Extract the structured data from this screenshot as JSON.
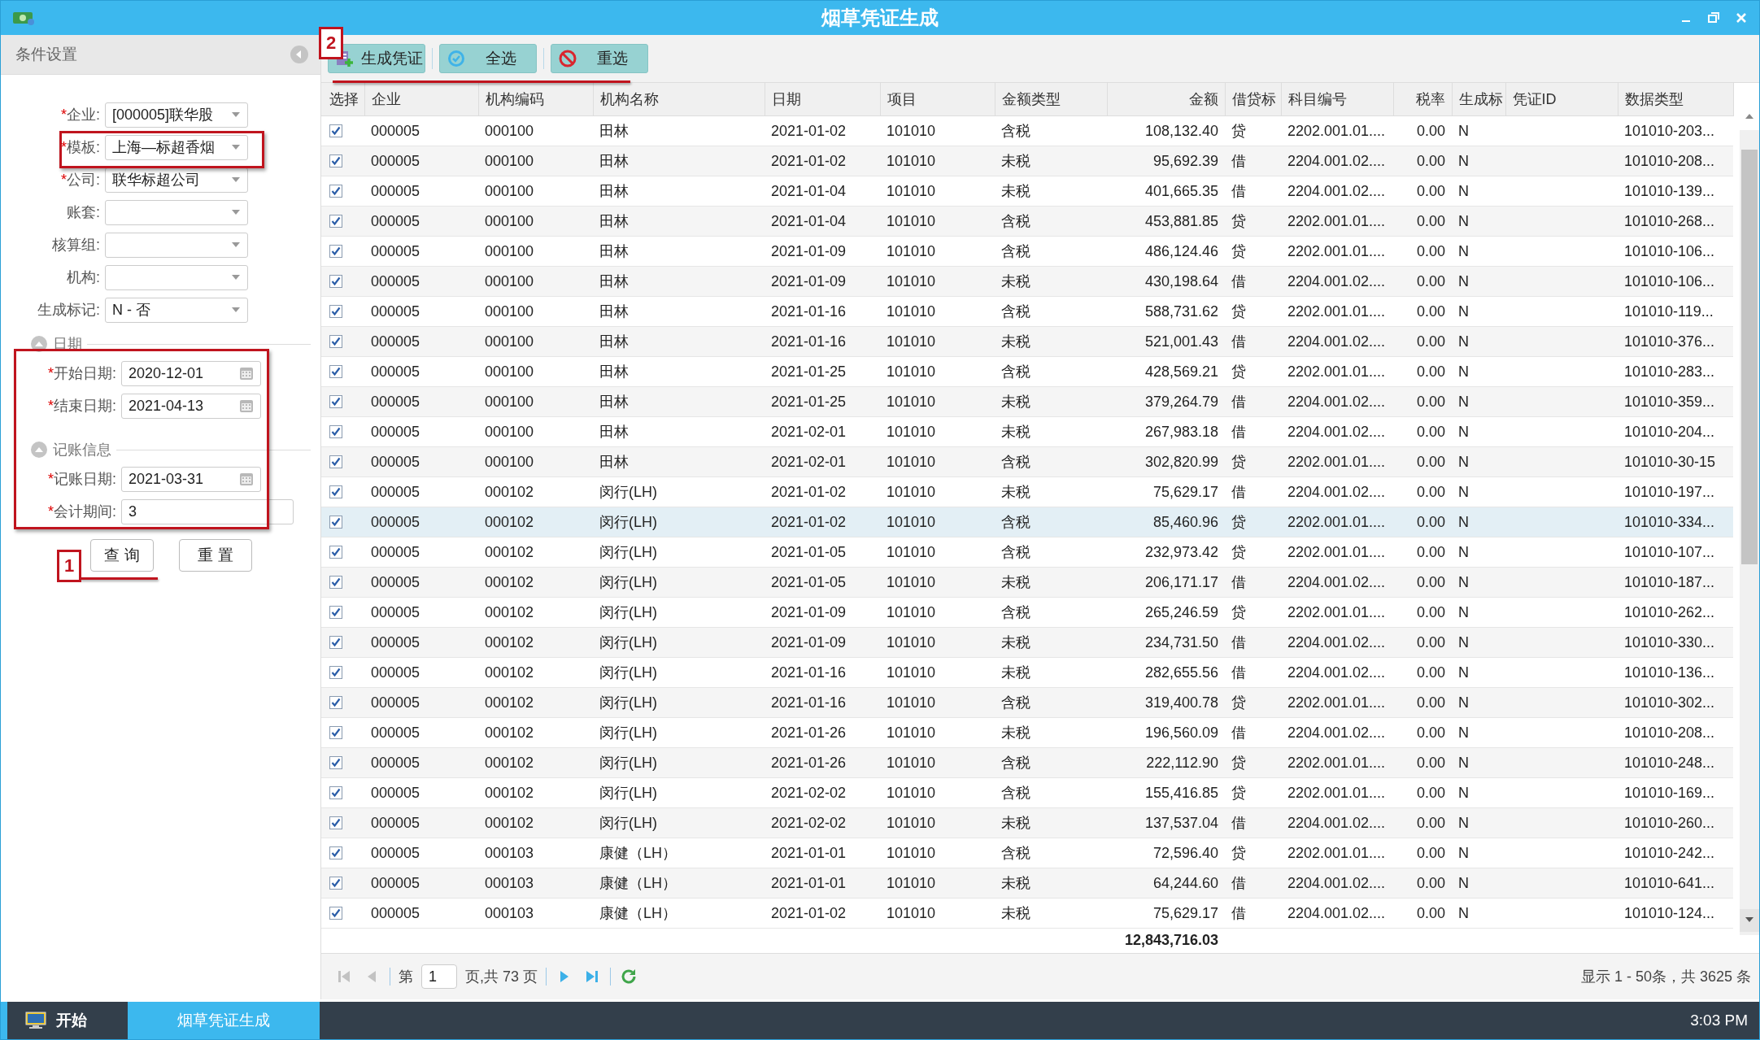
{
  "window": {
    "title": "烟草凭证生成"
  },
  "filter_panel": {
    "title": "条件设置",
    "fields": [
      {
        "kind": "select",
        "mark": "*",
        "label": "企业:",
        "value": "[000005]联华股"
      },
      {
        "kind": "select",
        "mark": "*",
        "label": "模板:",
        "value": "上海—标超香烟"
      },
      {
        "kind": "select",
        "mark": "*",
        "label": "公司:",
        "value": "联华标超公司"
      },
      {
        "kind": "select",
        "label": "账套:"
      },
      {
        "kind": "select",
        "label": "核算组:"
      },
      {
        "kind": "select",
        "label": "机构:"
      },
      {
        "kind": "select",
        "label": "生成标记:",
        "value": "N - 否"
      }
    ],
    "sections": [
      {
        "title": "日期",
        "expanded": true,
        "fields": [
          {
            "kind": "date",
            "mark": "*",
            "label": "开始日期:",
            "value": "2020-12-01"
          },
          {
            "kind": "date",
            "mark": "*",
            "label": "结束日期:",
            "value": "2021-04-13"
          }
        ]
      },
      {
        "title": "记账信息",
        "expanded": true,
        "fields": [
          {
            "kind": "date",
            "mark": "*",
            "label": "记账日期:",
            "value": "2021-03-31"
          },
          {
            "kind": "text",
            "mark": "*",
            "label": "会计期间:",
            "value": "3"
          }
        ]
      }
    ],
    "buttons": [
      "查 询",
      "重 置"
    ]
  },
  "toolbar": [
    {
      "kind": "generate",
      "label": "生成凭证"
    },
    {
      "kind": "select_all",
      "label": "全选"
    },
    {
      "kind": "reset",
      "label": "重选"
    }
  ],
  "table": {
    "columns": [
      {
        "label": "选择",
        "kind": "check"
      },
      {
        "label": "企业",
        "kind": "text"
      },
      {
        "label": "机构编码",
        "kind": "text"
      },
      {
        "label": "机构名称",
        "kind": "text"
      },
      {
        "label": "日期",
        "kind": "text"
      },
      {
        "label": "项目",
        "kind": "text"
      },
      {
        "label": "金额类型",
        "kind": "text"
      },
      {
        "label": "金额",
        "kind": "number"
      },
      {
        "label": "借贷标",
        "kind": "text"
      },
      {
        "label": "科目编号",
        "kind": "text"
      },
      {
        "label": "税率",
        "kind": "number"
      },
      {
        "label": "生成标",
        "kind": "text"
      },
      {
        "label": "凭证ID",
        "kind": "empty"
      },
      {
        "label": "数据类型",
        "kind": "text"
      }
    ],
    "rows": [
      {
        "checked": true,
        "selected": false,
        "cells": [
          "",
          "000005",
          "000100",
          "田林",
          "2021-01-02",
          "101010",
          "含税",
          "108,132.40",
          "贷",
          "2202.001.01....",
          "0.00",
          "N",
          "",
          "101010-203..."
        ]
      },
      {
        "checked": true,
        "selected": false,
        "cells": [
          "",
          "000005",
          "000100",
          "田林",
          "2021-01-02",
          "101010",
          "未税",
          "95,692.39",
          "借",
          "2204.001.02....",
          "0.00",
          "N",
          "",
          "101010-208..."
        ]
      },
      {
        "checked": true,
        "selected": false,
        "cells": [
          "",
          "000005",
          "000100",
          "田林",
          "2021-01-04",
          "101010",
          "未税",
          "401,665.35",
          "借",
          "2204.001.02....",
          "0.00",
          "N",
          "",
          "101010-139..."
        ]
      },
      {
        "checked": true,
        "selected": false,
        "cells": [
          "",
          "000005",
          "000100",
          "田林",
          "2021-01-04",
          "101010",
          "含税",
          "453,881.85",
          "贷",
          "2202.001.01....",
          "0.00",
          "N",
          "",
          "101010-268..."
        ]
      },
      {
        "checked": true,
        "selected": false,
        "cells": [
          "",
          "000005",
          "000100",
          "田林",
          "2021-01-09",
          "101010",
          "含税",
          "486,124.46",
          "贷",
          "2202.001.01....",
          "0.00",
          "N",
          "",
          "101010-106..."
        ]
      },
      {
        "checked": true,
        "selected": false,
        "cells": [
          "",
          "000005",
          "000100",
          "田林",
          "2021-01-09",
          "101010",
          "未税",
          "430,198.64",
          "借",
          "2204.001.02....",
          "0.00",
          "N",
          "",
          "101010-106..."
        ]
      },
      {
        "checked": true,
        "selected": false,
        "cells": [
          "",
          "000005",
          "000100",
          "田林",
          "2021-01-16",
          "101010",
          "含税",
          "588,731.62",
          "贷",
          "2202.001.01....",
          "0.00",
          "N",
          "",
          "101010-119..."
        ]
      },
      {
        "checked": true,
        "selected": false,
        "cells": [
          "",
          "000005",
          "000100",
          "田林",
          "2021-01-16",
          "101010",
          "未税",
          "521,001.43",
          "借",
          "2204.001.02....",
          "0.00",
          "N",
          "",
          "101010-376..."
        ]
      },
      {
        "checked": true,
        "selected": false,
        "cells": [
          "",
          "000005",
          "000100",
          "田林",
          "2021-01-25",
          "101010",
          "含税",
          "428,569.21",
          "贷",
          "2202.001.01....",
          "0.00",
          "N",
          "",
          "101010-283..."
        ]
      },
      {
        "checked": true,
        "selected": false,
        "cells": [
          "",
          "000005",
          "000100",
          "田林",
          "2021-01-25",
          "101010",
          "未税",
          "379,264.79",
          "借",
          "2204.001.02....",
          "0.00",
          "N",
          "",
          "101010-359..."
        ]
      },
      {
        "checked": true,
        "selected": false,
        "cells": [
          "",
          "000005",
          "000100",
          "田林",
          "2021-02-01",
          "101010",
          "未税",
          "267,983.18",
          "借",
          "2204.001.02....",
          "0.00",
          "N",
          "",
          "101010-204..."
        ]
      },
      {
        "checked": true,
        "selected": false,
        "cells": [
          "",
          "000005",
          "000100",
          "田林",
          "2021-02-01",
          "101010",
          "含税",
          "302,820.99",
          "贷",
          "2202.001.01....",
          "0.00",
          "N",
          "",
          "101010-30-15"
        ]
      },
      {
        "checked": true,
        "selected": false,
        "cells": [
          "",
          "000005",
          "000102",
          "闵行(LH)",
          "2021-01-02",
          "101010",
          "未税",
          "75,629.17",
          "借",
          "2204.001.02....",
          "0.00",
          "N",
          "",
          "101010-197..."
        ]
      },
      {
        "checked": true,
        "selected": true,
        "cells": [
          "",
          "000005",
          "000102",
          "闵行(LH)",
          "2021-01-02",
          "101010",
          "含税",
          "85,460.96",
          "贷",
          "2202.001.01....",
          "0.00",
          "N",
          "",
          "101010-334..."
        ]
      },
      {
        "checked": true,
        "selected": false,
        "cells": [
          "",
          "000005",
          "000102",
          "闵行(LH)",
          "2021-01-05",
          "101010",
          "含税",
          "232,973.42",
          "贷",
          "2202.001.01....",
          "0.00",
          "N",
          "",
          "101010-107..."
        ]
      },
      {
        "checked": true,
        "selected": false,
        "cells": [
          "",
          "000005",
          "000102",
          "闵行(LH)",
          "2021-01-05",
          "101010",
          "未税",
          "206,171.17",
          "借",
          "2204.001.02....",
          "0.00",
          "N",
          "",
          "101010-187..."
        ]
      },
      {
        "checked": true,
        "selected": false,
        "cells": [
          "",
          "000005",
          "000102",
          "闵行(LH)",
          "2021-01-09",
          "101010",
          "含税",
          "265,246.59",
          "贷",
          "2202.001.01....",
          "0.00",
          "N",
          "",
          "101010-262..."
        ]
      },
      {
        "checked": true,
        "selected": false,
        "cells": [
          "",
          "000005",
          "000102",
          "闵行(LH)",
          "2021-01-09",
          "101010",
          "未税",
          "234,731.50",
          "借",
          "2204.001.02....",
          "0.00",
          "N",
          "",
          "101010-330..."
        ]
      },
      {
        "checked": true,
        "selected": false,
        "cells": [
          "",
          "000005",
          "000102",
          "闵行(LH)",
          "2021-01-16",
          "101010",
          "未税",
          "282,655.56",
          "借",
          "2204.001.02....",
          "0.00",
          "N",
          "",
          "101010-136..."
        ]
      },
      {
        "checked": true,
        "selected": false,
        "cells": [
          "",
          "000005",
          "000102",
          "闵行(LH)",
          "2021-01-16",
          "101010",
          "含税",
          "319,400.78",
          "贷",
          "2202.001.01....",
          "0.00",
          "N",
          "",
          "101010-302..."
        ]
      },
      {
        "checked": true,
        "selected": false,
        "cells": [
          "",
          "000005",
          "000102",
          "闵行(LH)",
          "2021-01-26",
          "101010",
          "未税",
          "196,560.09",
          "借",
          "2204.001.02....",
          "0.00",
          "N",
          "",
          "101010-208..."
        ]
      },
      {
        "checked": true,
        "selected": false,
        "cells": [
          "",
          "000005",
          "000102",
          "闵行(LH)",
          "2021-01-26",
          "101010",
          "含税",
          "222,112.90",
          "贷",
          "2202.001.01....",
          "0.00",
          "N",
          "",
          "101010-248..."
        ]
      },
      {
        "checked": true,
        "selected": false,
        "cells": [
          "",
          "000005",
          "000102",
          "闵行(LH)",
          "2021-02-02",
          "101010",
          "含税",
          "155,416.85",
          "贷",
          "2202.001.01....",
          "0.00",
          "N",
          "",
          "101010-169..."
        ]
      },
      {
        "checked": true,
        "selected": false,
        "cells": [
          "",
          "000005",
          "000102",
          "闵行(LH)",
          "2021-02-02",
          "101010",
          "未税",
          "137,537.04",
          "借",
          "2204.001.02....",
          "0.00",
          "N",
          "",
          "101010-260..."
        ]
      },
      {
        "checked": true,
        "selected": false,
        "cells": [
          "",
          "000005",
          "000103",
          "康健（LH）",
          "2021-01-01",
          "101010",
          "含税",
          "72,596.40",
          "贷",
          "2202.001.01....",
          "0.00",
          "N",
          "",
          "101010-242..."
        ]
      },
      {
        "checked": true,
        "selected": false,
        "cells": [
          "",
          "000005",
          "000103",
          "康健（LH）",
          "2021-01-01",
          "101010",
          "未税",
          "64,244.60",
          "借",
          "2204.001.02....",
          "0.00",
          "N",
          "",
          "101010-641..."
        ]
      },
      {
        "checked": true,
        "selected": false,
        "cells": [
          "",
          "000005",
          "000103",
          "康健（LH）",
          "2021-01-02",
          "101010",
          "未税",
          "75,629.17",
          "借",
          "2204.001.02....",
          "0.00",
          "N",
          "",
          "101010-124..."
        ]
      }
    ],
    "total": "12,843,716.03"
  },
  "pager": {
    "controls": [
      {
        "kind": "first",
        "disabled": true
      },
      {
        "kind": "prev",
        "disabled": true
      },
      {
        "kind": "page_label",
        "text": "第"
      },
      {
        "kind": "page_input",
        "value": "1"
      },
      {
        "kind": "page_count",
        "text": "页,共 73 页"
      },
      {
        "kind": "next",
        "disabled": false
      },
      {
        "kind": "last",
        "disabled": false
      },
      {
        "kind": "refresh",
        "disabled": false
      }
    ],
    "summary": "显示 1 - 50条，共 3625 条"
  },
  "taskbar": {
    "start": "开始",
    "tasks": [
      {
        "label": "烟草凭证生成",
        "selected": true
      }
    ],
    "clock": "3:03 PM"
  },
  "annotations": [
    {
      "label": "1"
    },
    {
      "label": "2"
    }
  ]
}
